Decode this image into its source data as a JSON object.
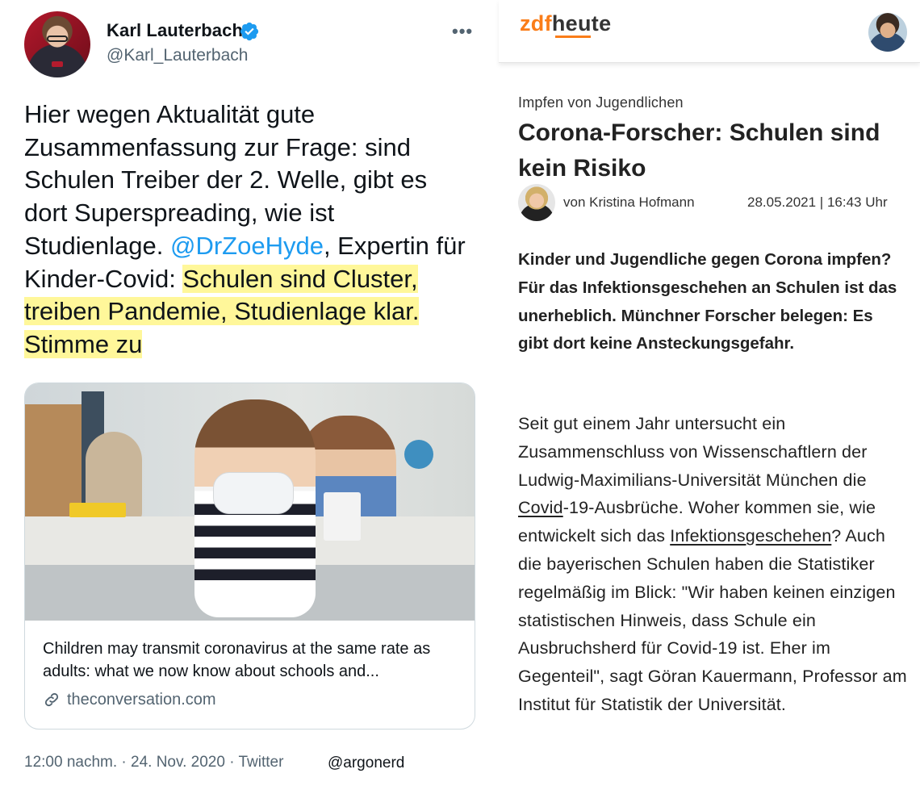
{
  "tweet": {
    "author_name": "Karl Lauterbach",
    "handle": "@Karl_Lauterbach",
    "more_label": "•••",
    "text_part1": "Hier wegen Aktualität gute Zusammenfassung zur Frage: sind Schulen Treiber der 2. Welle, gibt es dort Superspreading, wie ist Studienlage. ",
    "mention": "@DrZoeHyde",
    "text_part2": ", Expertin für Kinder-Covid: ",
    "highlight": "Schulen sind Cluster, treiben Pandemie, Studienlage klar. Stimme zu",
    "highlight_color": "#fff79a",
    "card": {
      "title": "Children may transmit coronavirus at the same rate as adults: what we now know about schools and...",
      "domain": "theconversation.com"
    },
    "meta": "12:00 nachm. · 24. Nov. 2020 · Twitter",
    "watermark": "@argonerd"
  },
  "article": {
    "logo_zdf": "zdf",
    "logo_heute": "heute",
    "accent_color": "#fa7d19",
    "kicker": "Impfen von Jugendlichen",
    "headline": "Corona-Forscher: Schulen sind kein Risiko",
    "byline": "von Kristina Hofmann",
    "date": "28.05.2021 | 16:43 Uhr",
    "lead": "Kinder und Jugendliche gegen Corona impfen? Für das Infektionsgeschehen an Schulen ist das unerheblich. Münchner Forscher belegen: Es gibt dort keine Ansteckungsgefahr.",
    "body_part1": "Seit gut einem Jahr untersucht ein Zusammenschluss von Wissenschaftlern der Ludwig-Maximilians-Universität München die ",
    "body_link1": "Covid",
    "body_part2": "-19-Ausbrüche. Woher kommen sie, wie entwickelt sich das ",
    "body_link2": "Infektionsgeschehen",
    "body_part3": "? Auch die bayerischen Schulen haben die Statistiker regelmäßig im Blick: \"Wir haben keinen einzigen statistischen Hinweis, dass Schule ein Ausbruchsherd für Covid-19 ist. Eher im Gegenteil\", sagt Göran Kauermann, Professor am Institut für Statistik der Universität."
  }
}
